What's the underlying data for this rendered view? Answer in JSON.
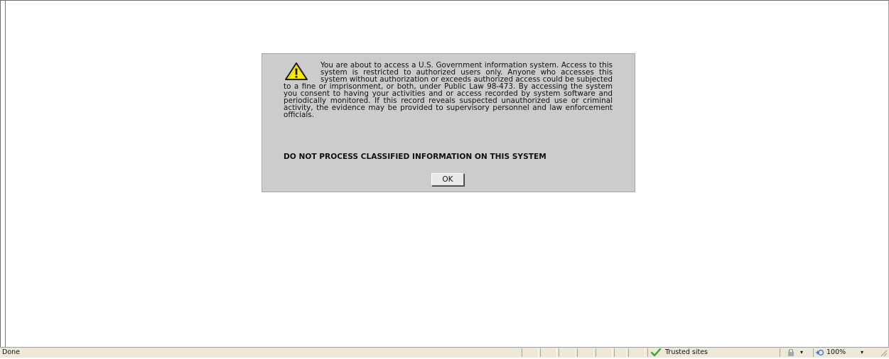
{
  "dialog": {
    "message": "You are about to access a U.S. Government information system. Access to this system is restricted to authorized users only. Anyone who accesses this system without authorization or exceeds authorized access could be subjected to a fine or imprisonment, or both, under Public Law 98-473. By accessing the system you consent to having your activities and or access recorded by system software and periodically monitored. If this record reveals suspected unauthorized use or criminal activity, the evidence may be provided to supervisory personnel and law enforcement officials.",
    "classified_notice": "DO NOT PROCESS CLASSIFIED INFORMATION ON THIS SYSTEM",
    "ok_label": "OK",
    "icon": "warning-icon"
  },
  "statusbar": {
    "status_text": "Done",
    "zone_label": "Trusted sites",
    "zone_icon": "checkmark-icon",
    "zoom_label": "100%",
    "protected_mode_icon": "lock-icon"
  },
  "colors": {
    "dialog_bg": "#cccccc",
    "statusbar_bg": "#ece9d8",
    "warning_yellow": "#ffee00",
    "trusted_green": "#3aa53a"
  }
}
